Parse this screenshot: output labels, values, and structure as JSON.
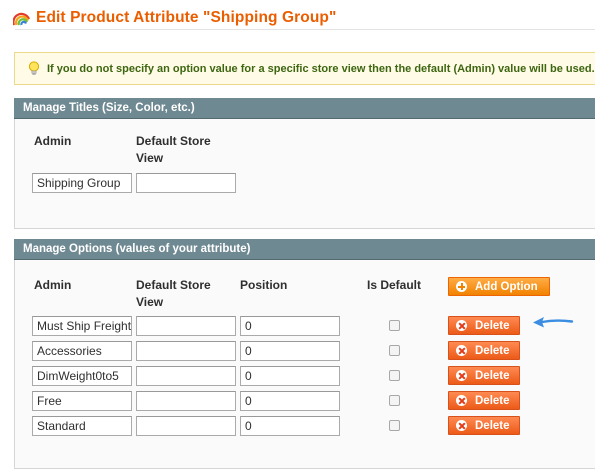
{
  "header": {
    "title": "Edit Product Attribute \"Shipping Group\"",
    "icon": "rainbow-icon"
  },
  "notice": {
    "icon": "lightbulb-icon",
    "text": "If you do not specify an option value for a specific store view then the default (Admin) value will be used."
  },
  "titles_section": {
    "heading": "Manage Titles (Size, Color, etc.)",
    "col_admin": "Admin",
    "col_default_store_1": "Default Store",
    "col_default_store_2": "View",
    "admin_value": "Shipping Group",
    "default_store_value": ""
  },
  "options_section": {
    "heading": "Manage Options (values of your attribute)",
    "col_admin": "Admin",
    "col_default_store_1": "Default Store",
    "col_default_store_2": "View",
    "col_position": "Position",
    "col_is_default": "Is Default",
    "add_option_label": "Add Option",
    "delete_label": "Delete",
    "rows": [
      {
        "admin": "Must Ship Freight",
        "default_store": "",
        "position": "0",
        "is_default": false
      },
      {
        "admin": "Accessories",
        "default_store": "",
        "position": "0",
        "is_default": false
      },
      {
        "admin": "DimWeight0to5",
        "default_store": "",
        "position": "0",
        "is_default": false
      },
      {
        "admin": "Free",
        "default_store": "",
        "position": "0",
        "is_default": false
      },
      {
        "admin": "Standard",
        "default_store": "",
        "position": "0",
        "is_default": false
      }
    ]
  },
  "colors": {
    "title_orange": "#eb5e00",
    "section_header": "#6f8992",
    "button_orange": "#f18200",
    "arrow_blue": "#3a8de0"
  }
}
